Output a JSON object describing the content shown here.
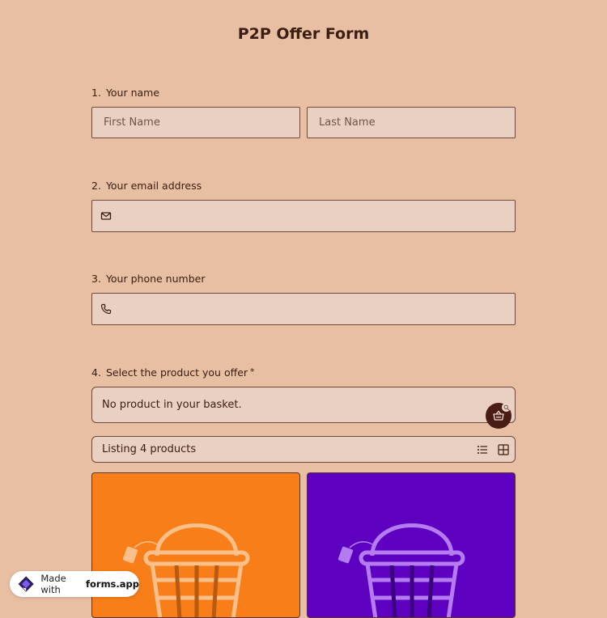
{
  "form": {
    "title": "P2P Offer Form"
  },
  "questions": {
    "name": {
      "number": "1.",
      "label": "Your name",
      "first_placeholder": "First Name",
      "last_placeholder": "Last Name"
    },
    "email": {
      "number": "2.",
      "label": "Your email address",
      "icon": "envelope-icon"
    },
    "phone": {
      "number": "3.",
      "label": "Your phone number",
      "icon": "phone-icon"
    },
    "product": {
      "number": "4.",
      "label": "Select the product you offer",
      "required_mark": "*",
      "basket_text": "No product in your basket.",
      "listing_text": "Listing 4 products",
      "basket_icon": "shopping-basket-icon"
    }
  },
  "products": [
    {
      "color": "#f77e19",
      "icon": "basket-icon"
    },
    {
      "color": "#5e00c0",
      "icon": "basket-icon"
    }
  ],
  "footer": {
    "made_with": "Made with",
    "brand": "forms.app"
  },
  "colors": {
    "background": "#e8bfa3",
    "field_bg": "#ead0c3",
    "accent_dark": "#4a1c16"
  }
}
